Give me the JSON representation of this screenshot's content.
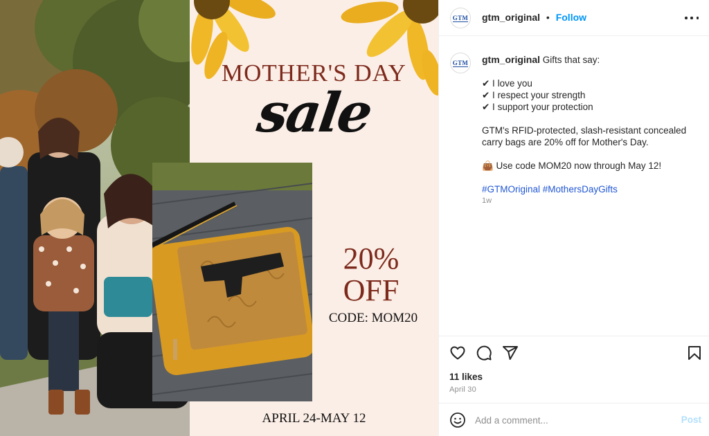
{
  "image": {
    "title_line": "MOTHER'S DAY",
    "script_word": "sale",
    "discount_pct": "20%",
    "discount_off": "OFF",
    "code": "CODE: MOM20",
    "dates": "APRIL 24-MAY 12"
  },
  "header": {
    "avatar_text": "GTM",
    "username": "gtm_original",
    "separator": "•",
    "follow_label": "Follow"
  },
  "caption": {
    "username": "gtm_original",
    "intro": "Gifts that say:",
    "lines": [
      "✔ I love you",
      "✔ I respect your strength",
      "✔ I support your protection"
    ],
    "body": "GTM's RFID-protected, slash-resistant concealed carry bags are 20% off for Mother's Day.",
    "promo": "👜 Use code MOM20 now through May 12!",
    "hashtag_1": "#GTMOriginal",
    "hashtag_2": "#MothersDayGifts",
    "age": "1w"
  },
  "engagement": {
    "likes": "11 likes",
    "date": "April 30"
  },
  "comment_box": {
    "placeholder": "Add a comment...",
    "post_label": "Post"
  },
  "icons": {
    "like": "heart-icon",
    "comment": "comment-icon",
    "share": "share-icon",
    "save": "bookmark-icon",
    "emoji": "emoji-icon",
    "more": "more-options-icon"
  },
  "colors": {
    "accent": "#0095f6",
    "brand_title": "#7d2a1c",
    "panel_bg": "#fbeee6"
  }
}
